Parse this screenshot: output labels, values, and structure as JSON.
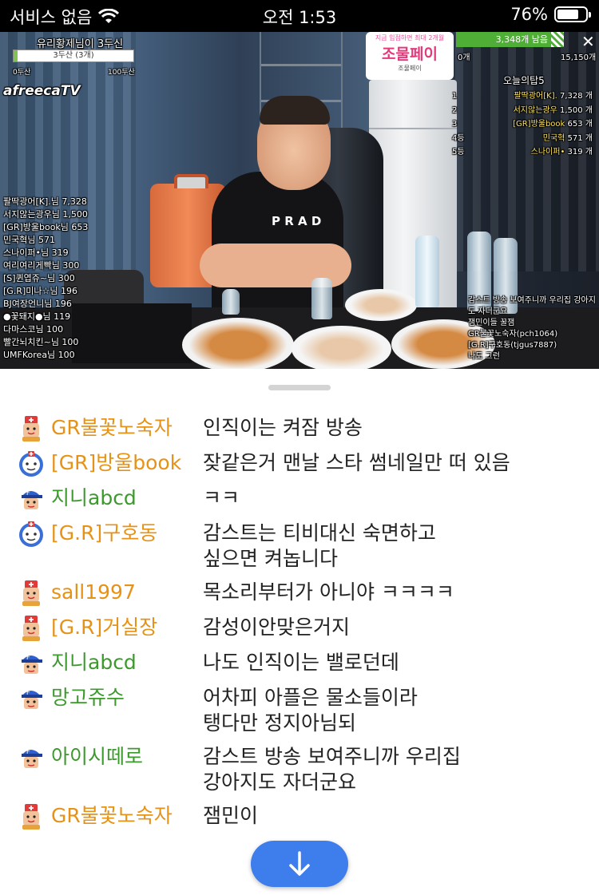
{
  "status_bar": {
    "carrier": "서비스 없음",
    "time": "오전 1:53",
    "battery": "76%",
    "battery_level": 0.76
  },
  "video": {
    "goal": {
      "title": "유리황제님이 3두신",
      "bar_text": "3두산 (3개)",
      "min": "0두산",
      "max": "100두산",
      "progress": 0.03
    },
    "logo": "afreecaTV",
    "promo": {
      "line1": "지금 입점하면 최대 2개월",
      "line2": "조물페이",
      "line3": "조물페이"
    },
    "count": {
      "remaining": "3,348개 남음",
      "min": "0개",
      "max": "15,150개"
    },
    "left_ranks": [
      "팔딱광어[K].님 7,328",
      "서지않는광우님 1,500",
      "[GR]방울book님 653",
      "민국혁님 571",
      "스나이퍼•님 319",
      "여리여리게빡님 300",
      "[S]퀸엽쥬~님 300",
      "[G.R]미나☆님 196",
      "BJ여장언니님 196",
      "●꽃돼지●님 119",
      "다마스코님 100",
      "빨간뇌치킨~님 100",
      "UMFKorea님 100"
    ],
    "today_title": "오늘의탑5",
    "today_top": [
      {
        "rank": "1",
        "name": "팔딱광어[K].",
        "value": "7,328 개"
      },
      {
        "rank": "2",
        "name": "서지않는광우",
        "value": "1,500 개"
      },
      {
        "rank": "3",
        "name": "[GR]방울book",
        "value": "653 개"
      },
      {
        "rank": "4등",
        "name": "민국혁",
        "value": "571 개"
      },
      {
        "rank": "5등",
        "name": "스나이퍼•",
        "value": "319 개"
      }
    ],
    "mini_chat": [
      "감스트 방송 보여주니까 우리집 강아지도 자더군요",
      "잼민이들 꿀잼",
      "GR불꽃노숙자(pch1064)",
      "[G.R]구호동(tjgus7887)",
      "나도 그런"
    ],
    "shirt_text": "P R A D"
  },
  "chat": [
    {
      "nick": "GR불꽃노숙자",
      "text": "인직이는 켜잠 방송",
      "color": "#e69216",
      "avatar": "fan-badge-icon"
    },
    {
      "nick": "[GR]방울book",
      "text": "잦같은거 맨날 스타 썸네일만 떠 있음",
      "color": "#e69216",
      "avatar": "clock-badge-icon"
    },
    {
      "nick": "지니abcd",
      "text": "ㅋㅋ",
      "color": "#3c9a2d",
      "avatar": "cap-avatar-icon"
    },
    {
      "nick": "[G.R]구호동",
      "text": "감스트는 티비대신 숙면하고\n싶으면 켜놉니다",
      "color": "#e69216",
      "avatar": "clock-badge-icon"
    },
    {
      "nick": "sall1997",
      "text": "목소리부터가 아니야 ㅋㅋㅋㅋ",
      "color": "#e69216",
      "avatar": "fan-badge-icon"
    },
    {
      "nick": "[G.R]거실장",
      "text": "감성이안맞은거지",
      "color": "#e69216",
      "avatar": "fan-badge-icon"
    },
    {
      "nick": "지니abcd",
      "text": "나도 인직이는 밸로던데",
      "color": "#3c9a2d",
      "avatar": "cap-avatar-icon"
    },
    {
      "nick": "망고쥬수",
      "text": "어차피 아플은 물소들이라\n탱다만 정지아님되",
      "color": "#3c9a2d",
      "avatar": "cap-avatar-icon"
    },
    {
      "nick": "아이시떼로",
      "text": "감스트 방송 보여주니까 우리집\n강아지도 자더군요",
      "color": "#3c9a2d",
      "avatar": "cap-avatar-icon"
    },
    {
      "nick": "GR불꽃노숙자",
      "text": "잼민이",
      "color": "#e69216",
      "avatar": "fan-badge-icon"
    }
  ],
  "scroll_button": {
    "icon": "arrow-down-icon"
  }
}
